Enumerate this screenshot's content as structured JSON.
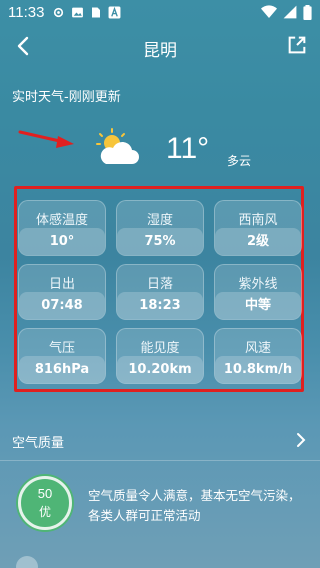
{
  "status_bar": {
    "time": "11:33"
  },
  "nav": {
    "title": "昆明"
  },
  "update_label": "实时天气-刚刚更新",
  "current": {
    "temperature": "11°",
    "condition": "多云"
  },
  "details": [
    {
      "label": "体感温度",
      "value": "10°"
    },
    {
      "label": "湿度",
      "value": "75%"
    },
    {
      "label": "西南风",
      "value": "2级"
    },
    {
      "label": "日出",
      "value": "07:48"
    },
    {
      "label": "日落",
      "value": "18:23"
    },
    {
      "label": "紫外线",
      "value": "中等"
    },
    {
      "label": "气压",
      "value": "816hPa"
    },
    {
      "label": "能见度",
      "value": "10.20km"
    },
    {
      "label": "风速",
      "value": "10.8km/h"
    }
  ],
  "air_quality": {
    "title": "空气质量",
    "aqi": "50",
    "level": "优",
    "description": "空气质量令人满意，基本无空气污染，各类人群可正常活动"
  },
  "colors": {
    "highlight": "#e02020",
    "aqi_good": "#4fb576",
    "arrow": "#e02020"
  }
}
